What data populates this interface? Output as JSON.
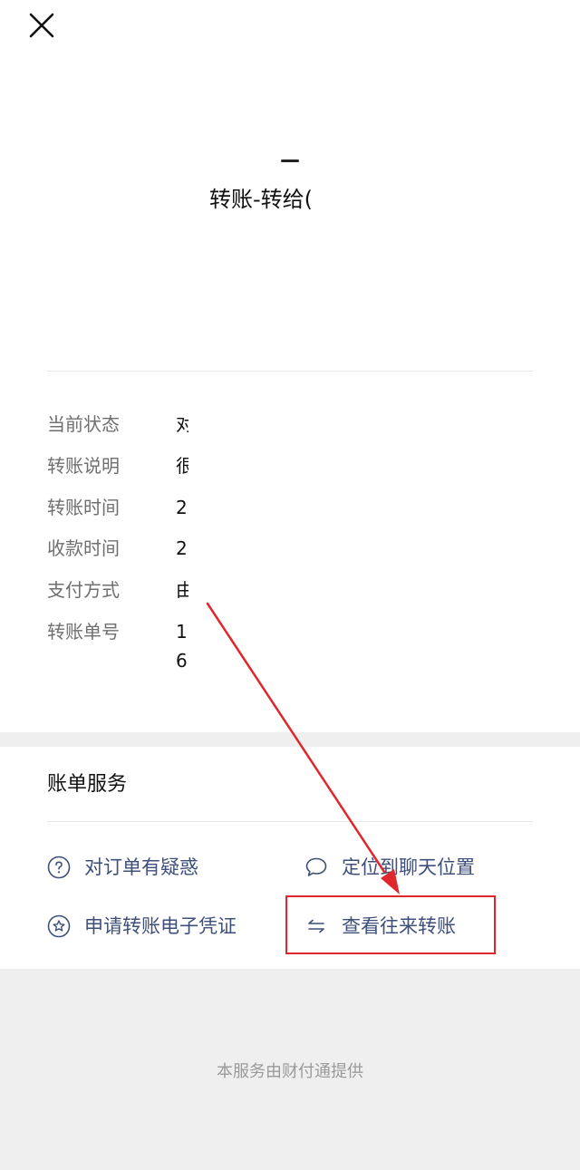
{
  "header": {
    "title": "转账-转给(",
    "close_icon": "close-icon"
  },
  "details": [
    {
      "label": "当前状态",
      "value": "对",
      "value2": ""
    },
    {
      "label": "转账说明",
      "value": "很",
      "value2": ""
    },
    {
      "label": "转账时间",
      "value": "2",
      "value2": ""
    },
    {
      "label": "收款时间",
      "value": "2",
      "value2": ""
    },
    {
      "label": "支付方式",
      "value": "由",
      "value2": ""
    },
    {
      "label": "转账单号",
      "value": "1",
      "value2": "6"
    }
  ],
  "services": {
    "title": "账单服务",
    "items": [
      {
        "label": "对订单有疑惑",
        "icon": "question-circle-icon"
      },
      {
        "label": "定位到聊天位置",
        "icon": "chat-bubble-icon"
      },
      {
        "label": "申请转账电子凭证",
        "icon": "star-badge-icon"
      },
      {
        "label": "查看往来转账",
        "icon": "transfer-arrows-icon"
      }
    ]
  },
  "footer": {
    "provider_text": "本服务由财付通提供"
  },
  "colors": {
    "service_text": "#3e4f7a",
    "annotation_red": "#e0272b",
    "page_background": "#ffffff",
    "footer_background": "#efefef"
  }
}
